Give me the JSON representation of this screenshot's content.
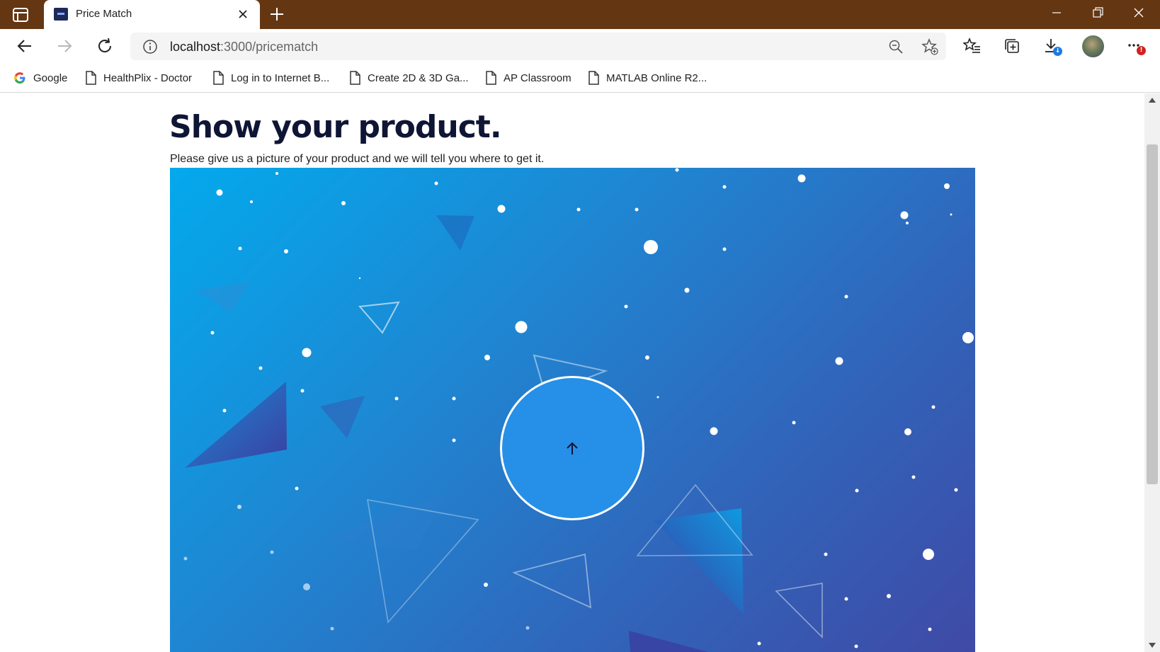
{
  "browser": {
    "tab": {
      "title": "Price Match"
    },
    "address_bar": {
      "host": "localhost",
      "path": ":3000/pricematch"
    },
    "download_badge": "↓",
    "menu_badge": "!",
    "bookmarks": [
      {
        "label": "Google",
        "icon": "google-icon"
      },
      {
        "label": "HealthPlix - Doctor",
        "icon": "page-icon"
      },
      {
        "label": "Log in to Internet B...",
        "icon": "page-icon"
      },
      {
        "label": "Create 2D & 3D Ga...",
        "icon": "page-icon"
      },
      {
        "label": "AP Classroom",
        "icon": "page-icon"
      },
      {
        "label": "MATLAB Online R2...",
        "icon": "page-icon"
      }
    ]
  },
  "page": {
    "heading": "Show your product.",
    "subtitle": "Please give us a picture of your product and we will tell you where to get it.",
    "upload_button": {
      "icon": "arrow-up-icon"
    }
  },
  "colors": {
    "titlebar": "#643612",
    "hero_gradient_start": "#03a9ec",
    "hero_gradient_end": "#3f4aa6",
    "upload_button": "#2690e8",
    "heading": "#0f1535"
  }
}
